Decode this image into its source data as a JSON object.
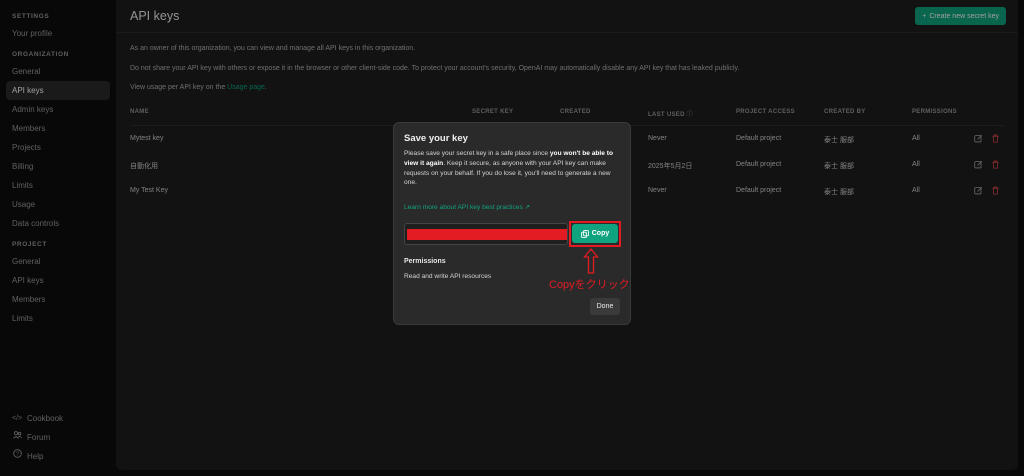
{
  "sidebar": {
    "settings_label": "SETTINGS",
    "settings_items": [
      "Your profile"
    ],
    "organization_label": "ORGANIZATION",
    "organization_items": [
      "General",
      "API keys",
      "Admin keys",
      "Members",
      "Projects",
      "Billing",
      "Limits",
      "Usage",
      "Data controls"
    ],
    "project_label": "PROJECT",
    "project_items": [
      "General",
      "API keys",
      "Members",
      "Limits"
    ],
    "footer": {
      "cookbook": "Cookbook",
      "forum": "Forum",
      "help": "Help"
    }
  },
  "header": {
    "title": "API keys",
    "create_button": "Create new secret key"
  },
  "intro": {
    "line1": "As an owner of this organization, you can view and manage all API keys in this organization.",
    "line2": "Do not share your API key with others or expose it in the browser or other client-side code. To protect your account's security, OpenAI may automatically disable any API key that has leaked publicly.",
    "line3_prefix": "View usage per API key on the ",
    "line3_link": "Usage page",
    "line3_suffix": "."
  },
  "table": {
    "columns": [
      "NAME",
      "SECRET KEY",
      "CREATED",
      "LAST USED",
      "PROJECT ACCESS",
      "CREATED BY",
      "PERMISSIONS"
    ],
    "rows": [
      {
        "name": "Mytest key",
        "last_used": "Never",
        "project": "Default project",
        "created_by": "泰士 服部",
        "permissions": "All"
      },
      {
        "name": "自動化用",
        "last_used": "2025年5月2日",
        "project": "Default project",
        "created_by": "泰士 服部",
        "permissions": "All"
      },
      {
        "name": "My Test Key",
        "last_used": "Never",
        "project": "Default project",
        "created_by": "泰士 服部",
        "permissions": "All"
      }
    ]
  },
  "modal": {
    "title": "Save your key",
    "desc_part1": "Please save your secret key in a safe place since ",
    "desc_bold": "you won't be able to view it again",
    "desc_part2": ". Keep it secure, as anyone with your API key can make requests on your behalf. If you do lose it, you'll need to generate a new one.",
    "best_practices_link": "Learn more about API key best practices",
    "copy_button": "Copy",
    "permissions_title": "Permissions",
    "permissions_value": "Read and write API resources",
    "done_button": "Done"
  },
  "annotation": {
    "label": "Copyをクリック"
  },
  "colors": {
    "accent": "#10a37f",
    "annotation_red": "#e31b23",
    "danger": "#e5484d"
  }
}
